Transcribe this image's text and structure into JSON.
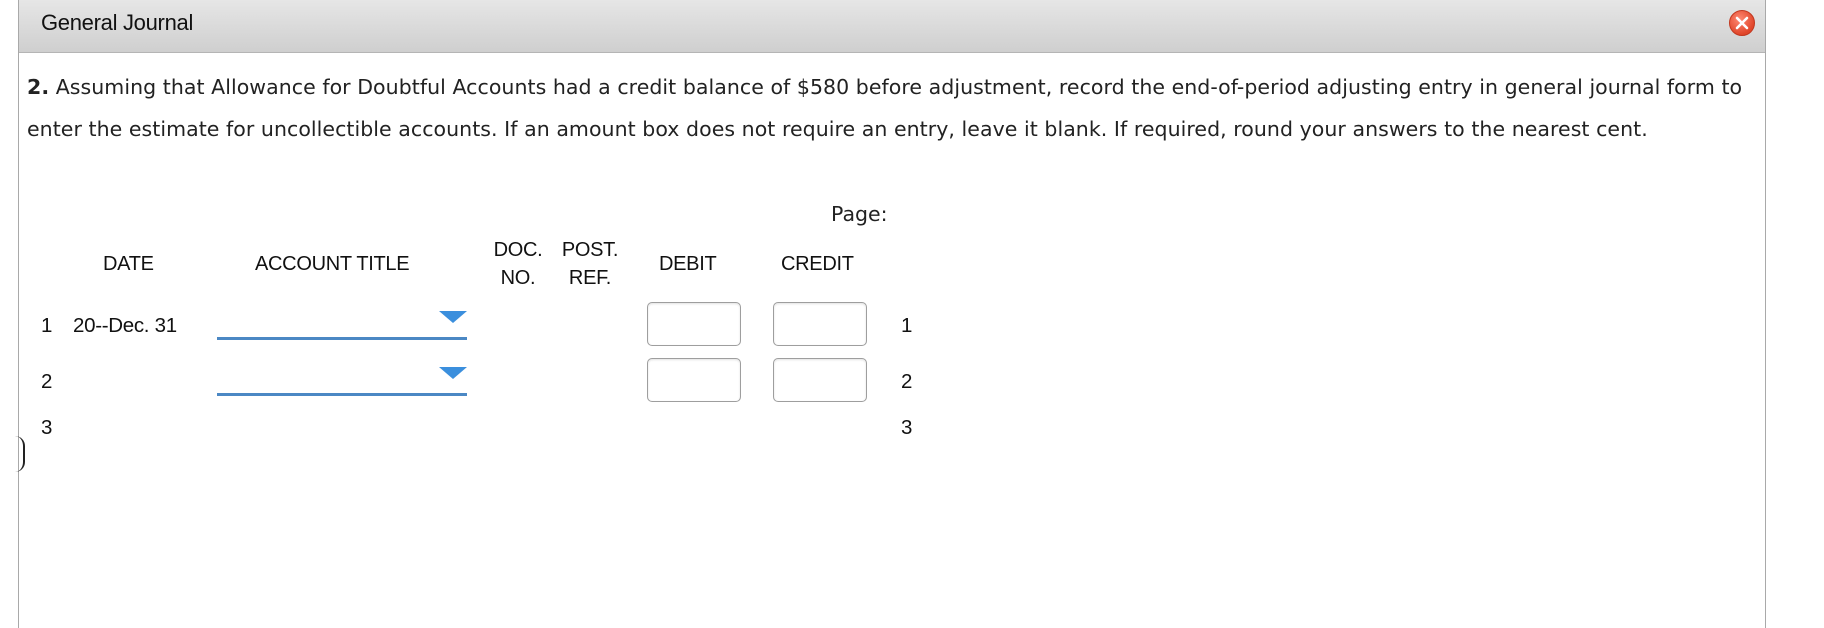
{
  "window": {
    "title": "General Journal"
  },
  "instructions": {
    "number": "2.",
    "text": "Assuming that Allowance for Doubtful Accounts had a credit balance of $580 before adjustment, record the end-of-period adjusting entry in general journal form to enter the estimate for uncollectible accounts. If an amount box does not require an entry, leave it blank. If required, round your answers to the nearest cent."
  },
  "journal": {
    "page_label": "Page:",
    "headers": {
      "date": "DATE",
      "account_title": "ACCOUNT TITLE",
      "doc_line1": "DOC.",
      "doc_line2": "NO.",
      "post_line1": "POST.",
      "post_line2": "REF.",
      "debit": "DEBIT",
      "credit": "CREDIT"
    },
    "rows": [
      {
        "num": "1",
        "date": "20--Dec. 31",
        "account": "",
        "debit": "",
        "credit": ""
      },
      {
        "num": "2",
        "date": "",
        "account": "",
        "debit": "",
        "credit": ""
      },
      {
        "num": "3",
        "date": ""
      }
    ]
  },
  "colors": {
    "titlebar": "#d8d8d8",
    "close_button": "#e0462a",
    "select_underline": "#4b88c4",
    "select_arrow": "#3b8fdd"
  },
  "icons": {
    "close": "close-icon",
    "dropdown": "chevron-down-icon"
  }
}
